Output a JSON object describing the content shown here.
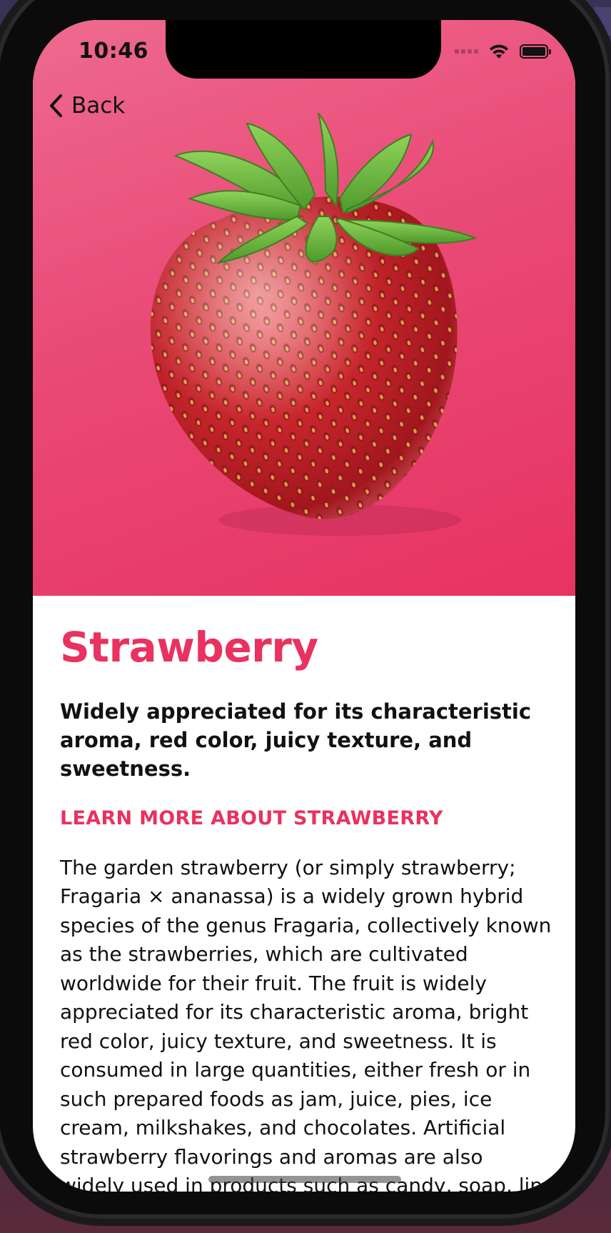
{
  "status_bar": {
    "time": "10:46"
  },
  "nav": {
    "back_label": "Back"
  },
  "fruit": {
    "title": "Strawberry",
    "headline": "Widely appreciated for its characteristic aroma,  red color, juicy texture, and sweetness.",
    "learn_more_label": "LEARN MORE ABOUT STRAWBERRY",
    "description": "The garden strawberry (or simply strawberry; Fragaria × ananassa) is a widely grown hybrid species of the genus Fragaria, collectively known as the strawberries, which are cultivated worldwide for their fruit. The fruit is widely appreciated for its characteristic aroma, bright red color, juicy texture, and sweetness. It is consumed in large quantities, either fresh or in such prepared foods as jam, juice, pies, ice cream, milkshakes, and chocolates. Artificial strawberry flavorings and aromas are also widely used in products such as candy, soap, lip gloss, perfume, and many others.",
    "image_icon": "strawberry-image"
  },
  "colors": {
    "accent": "#e9325f",
    "hero_gradient_start": "#ee6a8f",
    "hero_gradient_end": "#e83362",
    "text": "#111111"
  }
}
